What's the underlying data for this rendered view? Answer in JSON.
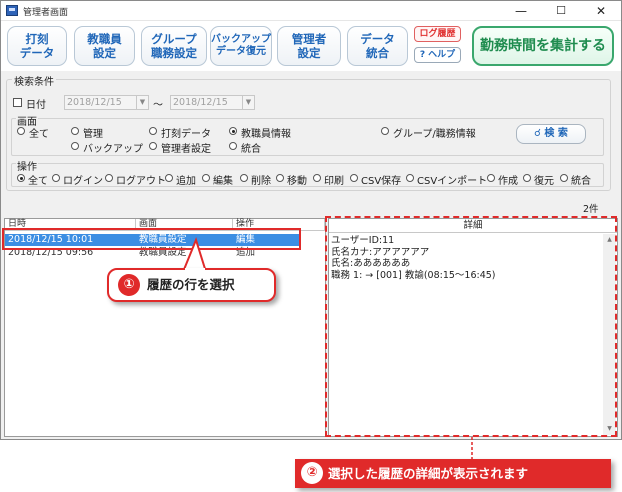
{
  "window": {
    "title": "管理者画面",
    "minimize": "—",
    "maximize": "☐",
    "close": "✕"
  },
  "toolbar": {
    "buttons": [
      "打刻\nデータ",
      "教職員\n設定",
      "グループ\n職務設定",
      "バックアップ\nデータ復元",
      "管理者\n設定",
      "データ\n統合"
    ],
    "log": "ログ履歴",
    "help": "? ヘルプ",
    "work_time": "勤務時間を集計する"
  },
  "search": {
    "legend": "検索条件",
    "date_label": "日付",
    "date_from": "2018/12/15",
    "date_to": "2018/12/15",
    "tilde": "～",
    "screen_legend": "画面",
    "screens": [
      "全て",
      "管理",
      "打刻データ",
      "教職員情報",
      "グループ/職務情報",
      "バックアップ",
      "管理者設定",
      "統合"
    ],
    "search_btn": "検 索",
    "op_legend": "操作",
    "ops": [
      "全て",
      "ログイン",
      "ログアウト",
      "追加",
      "編集",
      "削除",
      "移動",
      "印刷",
      "CSV保存",
      "CSVインポート",
      "作成",
      "復元",
      "統合"
    ]
  },
  "result_count": "2件",
  "grid": {
    "headers": [
      "日時",
      "画面",
      "操作"
    ],
    "rows": [
      {
        "datetime": "2018/12/15 10:01",
        "screen": "教職員設定",
        "op": "編集"
      },
      {
        "datetime": "2018/12/15 09:56",
        "screen": "教職員設定",
        "op": "追加"
      }
    ]
  },
  "detail": {
    "header": "詳細",
    "body": "ユーザーID:11\n氏名カナ:アアアアアア\n氏名:ああああああ\n職務 1: → [001] 教諭(08:15～16:45)"
  },
  "annotations": {
    "n1": "①",
    "t1": "履歴の行を選択",
    "n2": "②",
    "t2": "選択した履歴の詳細が表示されます",
    "accent": "#e02a2a"
  }
}
